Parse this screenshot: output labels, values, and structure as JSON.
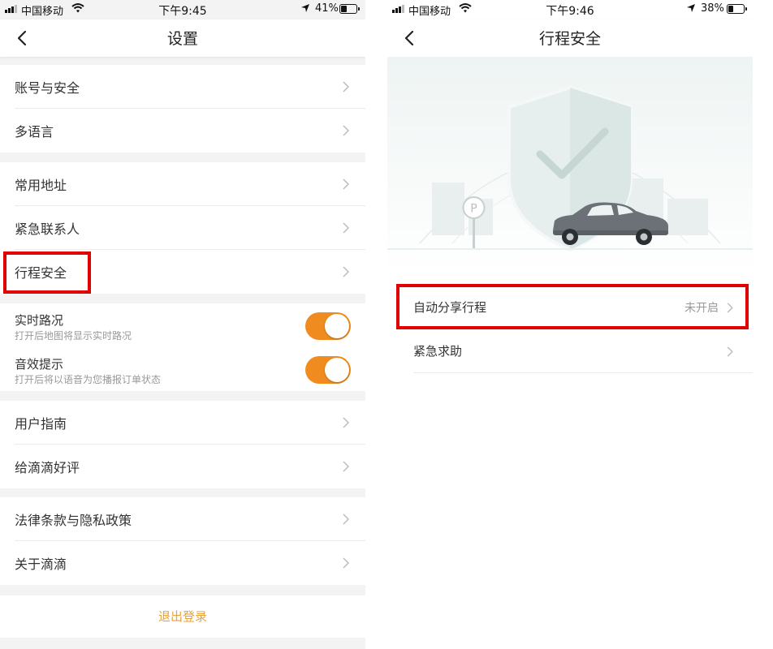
{
  "left": {
    "status": {
      "carrier": "中国移动",
      "time": "下午9:45",
      "battery": "41%",
      "battery_level": 0.41
    },
    "nav": {
      "title": "设置"
    },
    "groups": [
      {
        "items": [
          "账号与安全",
          "多语言"
        ]
      },
      {
        "items": [
          "常用地址",
          "紧急联系人",
          "行程安全"
        ]
      },
      {
        "toggles": [
          {
            "label": "实时路况",
            "sub": "打开后地图将显示实时路况",
            "on": true
          },
          {
            "label": "音效提示",
            "sub": "打开后将以语音为您播报订单状态",
            "on": true
          }
        ]
      },
      {
        "items": [
          "用户指南",
          "给滴滴好评"
        ]
      },
      {
        "items": [
          "法律条款与隐私政策",
          "关于滴滴"
        ]
      }
    ],
    "logout_label": "退出登录",
    "highlighted_item": "行程安全"
  },
  "right": {
    "status": {
      "carrier": "中国移动",
      "time": "下午9:46",
      "battery": "38%",
      "battery_level": 0.38
    },
    "nav": {
      "title": "行程安全"
    },
    "parking_sign": "P",
    "items": [
      {
        "label": "自动分享行程",
        "value": "未开启"
      },
      {
        "label": "紧急求助",
        "value": ""
      }
    ],
    "highlighted_item": "自动分享行程"
  },
  "colors": {
    "accent_orange": "#f08c1f",
    "logout_text": "#e6a23c",
    "highlight_red": "#e00000"
  }
}
